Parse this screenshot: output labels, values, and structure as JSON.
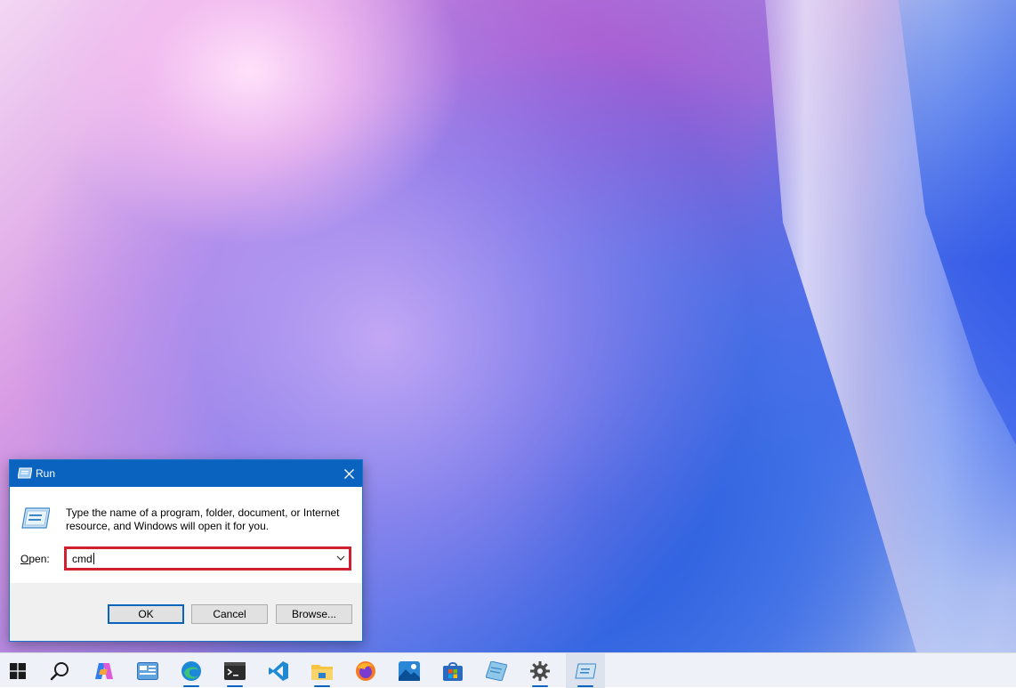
{
  "dialog": {
    "title": "Run",
    "description": "Type the name of a program, folder, document, or Internet resource, and Windows will open it for you.",
    "open_label_accel": "O",
    "open_label_rest": "pen:",
    "open_value": "cmd",
    "buttons": {
      "ok": "OK",
      "cancel": "Cancel",
      "browse": "Browse..."
    }
  },
  "taskbar": {
    "items": [
      {
        "icon": "windows-start-icon"
      },
      {
        "icon": "search-icon"
      },
      {
        "icon": "copilot-icon"
      },
      {
        "icon": "widget-board-icon"
      },
      {
        "icon": "edge-icon"
      },
      {
        "icon": "terminal-icon"
      },
      {
        "icon": "vscode-icon"
      },
      {
        "icon": "file-explorer-icon"
      },
      {
        "icon": "firefox-icon"
      },
      {
        "icon": "photos-icon"
      },
      {
        "icon": "microsoft-store-icon"
      },
      {
        "icon": "notepad-icon"
      },
      {
        "icon": "settings-icon"
      },
      {
        "icon": "run-icon",
        "active": true
      }
    ]
  },
  "colors": {
    "accent": "#0b63c0",
    "highlight_border": "#d0202f"
  }
}
